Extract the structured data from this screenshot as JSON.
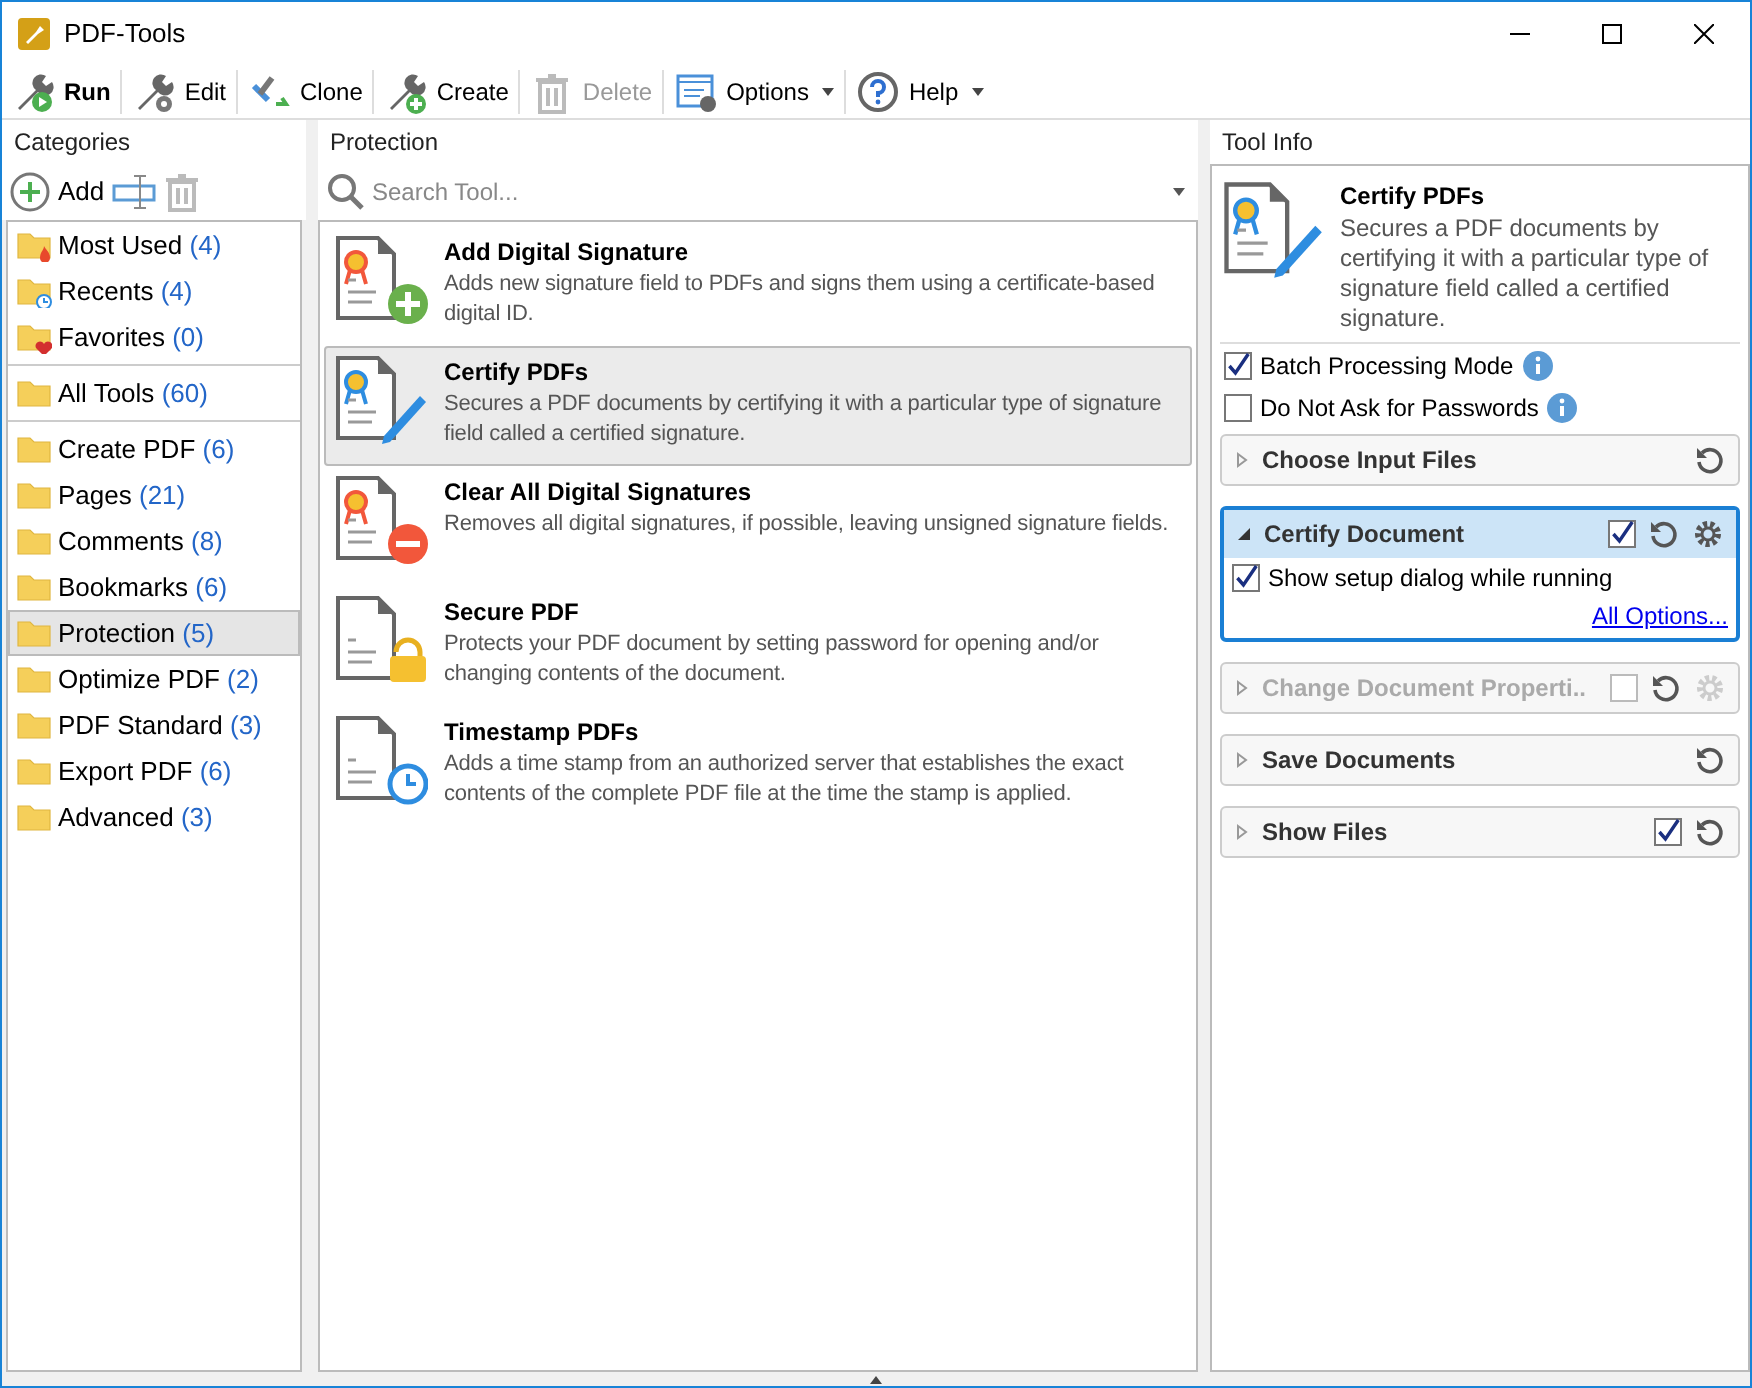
{
  "window": {
    "title": "PDF-Tools"
  },
  "toolbar": [
    {
      "label": "Run",
      "kind": "run",
      "bold": true,
      "disabled": false,
      "dropdown": false
    },
    {
      "label": "Edit",
      "kind": "edit",
      "bold": false,
      "disabled": false,
      "dropdown": false
    },
    {
      "label": "Clone",
      "kind": "clone",
      "bold": false,
      "disabled": false,
      "dropdown": false
    },
    {
      "label": "Create",
      "kind": "create",
      "bold": false,
      "disabled": false,
      "dropdown": false
    },
    {
      "label": "Delete",
      "kind": "delete",
      "bold": false,
      "disabled": true,
      "dropdown": false
    },
    {
      "label": "Options",
      "kind": "options",
      "bold": false,
      "disabled": false,
      "dropdown": true
    },
    {
      "label": "Help",
      "kind": "help",
      "bold": false,
      "disabled": false,
      "dropdown": true
    }
  ],
  "categories": {
    "title": "Categories",
    "add_label": "Add",
    "groups": [
      [
        {
          "name": "Most Used",
          "count": "(4)",
          "kind": "fire",
          "selected": false
        },
        {
          "name": "Recents",
          "count": "(4)",
          "kind": "clock",
          "selected": false
        },
        {
          "name": "Favorites",
          "count": "(0)",
          "kind": "heart",
          "selected": false
        }
      ],
      [
        {
          "name": "All Tools",
          "count": "(60)",
          "kind": "plain",
          "selected": false
        }
      ],
      [
        {
          "name": "Create PDF",
          "count": "(6)",
          "kind": "plain",
          "selected": false
        },
        {
          "name": "Pages",
          "count": "(21)",
          "kind": "plain",
          "selected": false
        },
        {
          "name": "Comments",
          "count": "(8)",
          "kind": "plain",
          "selected": false
        },
        {
          "name": "Bookmarks",
          "count": "(6)",
          "kind": "plain",
          "selected": false
        },
        {
          "name": "Protection",
          "count": "(5)",
          "kind": "plain",
          "selected": true
        },
        {
          "name": "Optimize PDF",
          "count": "(2)",
          "kind": "plain",
          "selected": false
        },
        {
          "name": "PDF Standard",
          "count": "(3)",
          "kind": "plain",
          "selected": false
        },
        {
          "name": "Export PDF",
          "count": "(6)",
          "kind": "plain",
          "selected": false
        },
        {
          "name": "Advanced",
          "count": "(3)",
          "kind": "plain",
          "selected": false
        }
      ]
    ]
  },
  "tools": {
    "title": "Protection",
    "placeholder": "Search Tool...",
    "items": [
      {
        "name": "Add Digital Signature",
        "description": "Adds new signature field to PDFs and signs them using a certificate-based digital ID.",
        "kind": "add",
        "selected": false
      },
      {
        "name": "Certify PDFs",
        "description": "Secures a PDF documents by certifying it with a particular type of signature field called a certified signature.",
        "kind": "certify",
        "selected": true
      },
      {
        "name": "Clear All Digital Signatures",
        "description": "Removes all digital signatures, if possible, leaving unsigned signature fields.",
        "kind": "clear",
        "selected": false
      },
      {
        "name": "Secure PDF",
        "description": "Protects your PDF document by setting password for opening and/or changing contents of the document.",
        "kind": "secure",
        "selected": false
      },
      {
        "name": "Timestamp PDFs",
        "description": "Adds a time stamp from an authorized server that establishes the exact contents of the complete PDF file at the time the stamp is applied.",
        "kind": "timestamp",
        "selected": false
      }
    ]
  },
  "tool_info": {
    "title": "Tool Info",
    "name": "Certify PDFs",
    "description": "Secures a PDF documents by certifying it with a particular type of signature field called a certified signature.",
    "kind": "certify",
    "options": [
      {
        "label": "Batch Processing Mode",
        "checked": true
      },
      {
        "label": "Do Not Ask for Passwords",
        "checked": false
      }
    ],
    "actions": [
      {
        "name": "Choose Input Files",
        "expanded": false,
        "disabled": false,
        "gear": false
      },
      {
        "name": "Certify Document",
        "expanded": true,
        "disabled": false,
        "checked": true,
        "gear": true,
        "setting": {
          "label": "Show setup dialog while running",
          "checked": true
        },
        "link": "All Options..."
      },
      {
        "name": "Change Document Properti..",
        "expanded": false,
        "disabled": true,
        "checked": false,
        "gear": true
      },
      {
        "name": "Save Documents",
        "expanded": false,
        "disabled": false,
        "gear": false
      },
      {
        "name": "Show Files",
        "expanded": false,
        "disabled": false,
        "checked": true,
        "gear": false
      }
    ]
  }
}
